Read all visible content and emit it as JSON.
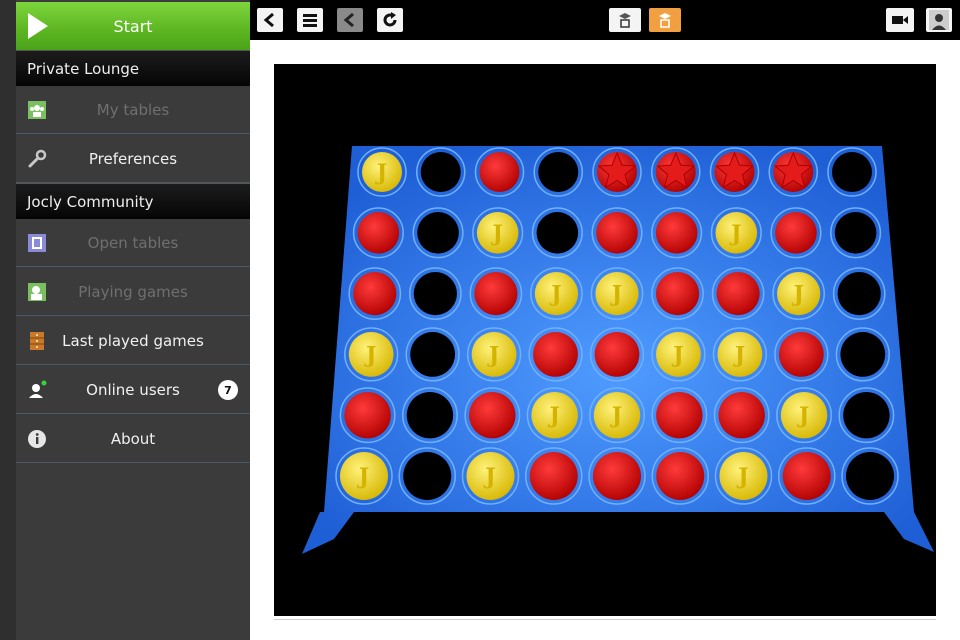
{
  "sidebar": {
    "start_label": "Start",
    "sections": [
      {
        "label": "Private Lounge"
      },
      {
        "label": "Jocly Community"
      }
    ],
    "items": [
      {
        "label": "My tables",
        "icon": "group-icon",
        "disabled": true
      },
      {
        "label": "Preferences",
        "icon": "wrench-icon",
        "disabled": false
      },
      {
        "label": "Open tables",
        "icon": "table-icon",
        "disabled": true
      },
      {
        "label": "Playing games",
        "icon": "players-icon",
        "disabled": true
      },
      {
        "label": "Last played games",
        "icon": "cabinet-icon",
        "disabled": false
      },
      {
        "label": "Online users",
        "icon": "user-online-icon",
        "disabled": false,
        "badge": "7"
      },
      {
        "label": "About",
        "icon": "info-icon",
        "disabled": false
      }
    ]
  },
  "toolbar": {
    "left_buttons": [
      "back-icon",
      "menu-icon",
      "undo-icon",
      "rotate-icon"
    ],
    "center_buttons": [
      "view-2d-icon",
      "view-3d-icon"
    ],
    "right_buttons": [
      "camera-icon",
      "avatar"
    ]
  },
  "board": {
    "columns": 9,
    "rows": 6,
    "frame_color": "#2a6fe0",
    "piece_colors": {
      "Y": "#f2df14",
      "R": "#e01010",
      "E": "#000000"
    },
    "winning_star_row": [
      4,
      5,
      6,
      7
    ],
    "cells": [
      [
        "Y",
        "E",
        "R",
        "E",
        "R",
        "R",
        "R",
        "R",
        "E"
      ],
      [
        "R",
        "E",
        "Y",
        "E",
        "R",
        "R",
        "Y",
        "R",
        "E"
      ],
      [
        "R",
        "E",
        "R",
        "Y",
        "Y",
        "R",
        "R",
        "Y",
        "E"
      ],
      [
        "Y",
        "E",
        "Y",
        "R",
        "R",
        "Y",
        "Y",
        "R",
        "E"
      ],
      [
        "R",
        "E",
        "R",
        "Y",
        "Y",
        "R",
        "R",
        "Y",
        "E"
      ],
      [
        "Y",
        "E",
        "Y",
        "R",
        "R",
        "R",
        "Y",
        "R",
        "E"
      ]
    ]
  }
}
